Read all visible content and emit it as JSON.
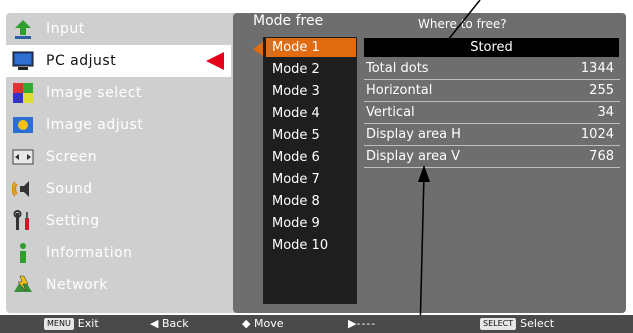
{
  "menu": {
    "items": [
      {
        "label": "Input",
        "icon": "input-arrow-icon"
      },
      {
        "label": "PC adjust",
        "icon": "pc-monitor-icon"
      },
      {
        "label": "Image select",
        "icon": "image-select-icon"
      },
      {
        "label": "Image adjust",
        "icon": "image-adjust-icon"
      },
      {
        "label": "Screen",
        "icon": "screen-icon"
      },
      {
        "label": "Sound",
        "icon": "speaker-icon"
      },
      {
        "label": "Setting",
        "icon": "setting-tools-icon"
      },
      {
        "label": "Information",
        "icon": "info-icon"
      },
      {
        "label": "Network",
        "icon": "network-icon"
      }
    ],
    "active_index": 1
  },
  "submenu": {
    "title": "Mode free",
    "modes": [
      "Mode 1",
      "Mode 2",
      "Mode 3",
      "Mode 4",
      "Mode 5",
      "Mode 6",
      "Mode 7",
      "Mode 8",
      "Mode 9",
      "Mode 10"
    ],
    "selected_index": 0
  },
  "panel": {
    "where_prompt": "Where to free?",
    "stored_label": "Stored",
    "rows": [
      {
        "name": "Total dots",
        "value": "1344"
      },
      {
        "name": "Horizontal",
        "value": "255"
      },
      {
        "name": "Vertical",
        "value": "34"
      },
      {
        "name": "Display area H",
        "value": "1024"
      },
      {
        "name": "Display area V",
        "value": "768"
      }
    ]
  },
  "bottom_bar": {
    "menu_key": "MENU",
    "exit": "Exit",
    "back_glyph": "◀",
    "back": "Back",
    "move_glyph": "◆",
    "move": "Move",
    "next_glyph": "▶",
    "next": "----",
    "select_key": "SELECT",
    "select": "Select"
  },
  "colors": {
    "active_arrow": "#e2001a",
    "mode_selected": "#e06b10",
    "submenu_bg": "#6e6e6e",
    "menu_bg": "#cfcfcf"
  }
}
